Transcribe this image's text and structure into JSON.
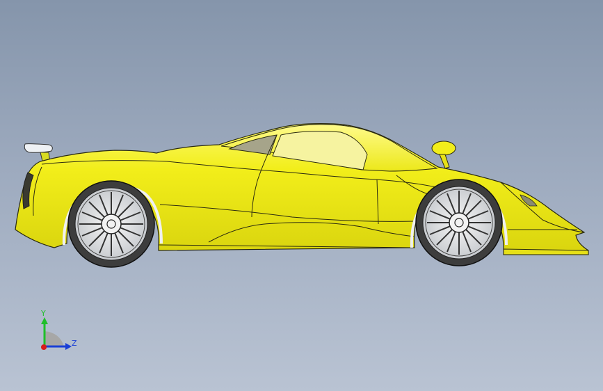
{
  "viewport": {
    "background_top": "#8595ab",
    "background_bottom": "#b9c3d3"
  },
  "model": {
    "body_color": "#f2ee1a",
    "highlight_color": "#fbf86a",
    "shadow_color": "#c9c40c",
    "edge_color": "#2a2a10",
    "glass_color": "#a6a48a",
    "wing_color": "#eef1f4",
    "tire_color": "#3d3d3d",
    "rim_color": "#e6e8ea"
  },
  "triad": {
    "y_label": "Y",
    "z_label": "Z",
    "y_color": "#1fbf2a",
    "z_color": "#1a3fd6",
    "x_color": "#d81b1b"
  }
}
